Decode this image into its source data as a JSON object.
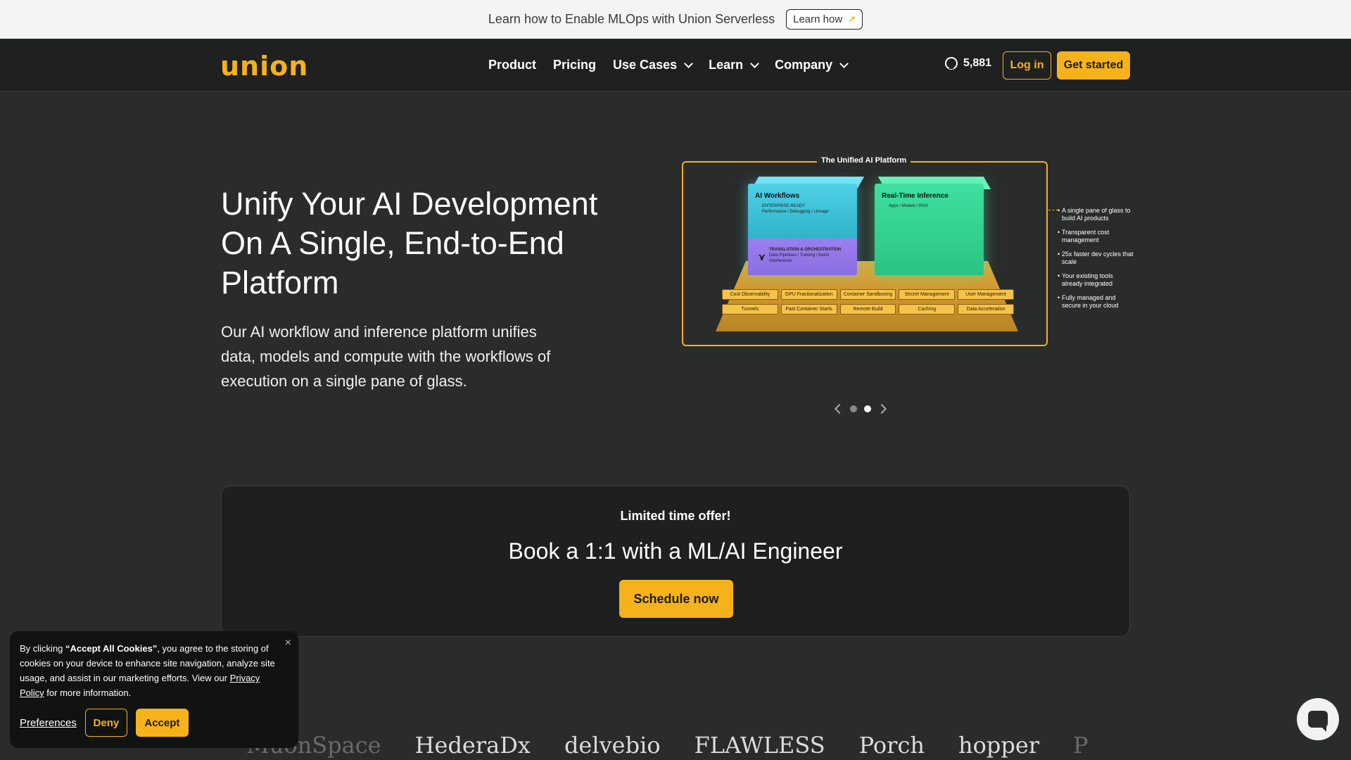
{
  "announcement": {
    "text": "Learn how to Enable MLOps with Union Serverless",
    "button": "Learn how",
    "button_icon": "arrow-up-right-icon"
  },
  "nav": {
    "logo": "union",
    "links": [
      {
        "label": "Product",
        "dropdown": false
      },
      {
        "label": "Pricing",
        "dropdown": false
      },
      {
        "label": "Use Cases",
        "dropdown": true
      },
      {
        "label": "Learn",
        "dropdown": true
      },
      {
        "label": "Company",
        "dropdown": true
      }
    ],
    "github_stars": "5,881",
    "login": "Log in",
    "get_started": "Get started"
  },
  "hero": {
    "title": "Unify Your AI Development On A Single, End-to-End Platform",
    "subtitle": "Our AI workflow and inference platform unifies data, models and compute with the workflows of execution on a single pane of glass."
  },
  "diagram": {
    "title": "The Unified AI Platform",
    "workflows_label": "AI Workflows",
    "workflows_sub": "ENTERPRISE-READY",
    "workflows_sub2": "Performance / Debugging / Lineage",
    "orchestration_label": "TRANSLATION & ORCHESTRATION",
    "orchestration_sub": "Data Pipelines / Training / Batch Interference",
    "inference_label": "Real-Time Inference",
    "inference_sub": "Apps / Models / RAG",
    "chips": [
      "Cost Observability",
      "GPU Fractionalization",
      "Container Sandboxing",
      "Secret Management",
      "User Management",
      "Tunnels",
      "Fast Container Starts",
      "Remote Build",
      "Caching",
      "Data Acceleration"
    ],
    "bullets": [
      "A single pane of glass to build AI products",
      "Transparent cost management",
      "25x faster dev cycles that scale",
      "Your existing tools already integrated",
      "Fully managed and secure in your cloud"
    ]
  },
  "carousel": {
    "current": 2,
    "total": 2
  },
  "offer": {
    "kicker": "Limited time offer!",
    "title": "Book a 1:1 with a ML/AI Engineer",
    "button": "Schedule now"
  },
  "logos": [
    "MuonSpace",
    "HederaDx",
    "delvebio",
    "FLAWLESS",
    "Porch",
    "hopper",
    "P"
  ],
  "cookie": {
    "text_prefix": "By clicking ",
    "text_bold": "“Accept All Cookies”",
    "text_middle": ", you agree to the storing of cookies on your device to enhance site navigation, analyze site usage, and assist in our marketing efforts. View our ",
    "text_link": "Privacy Policy",
    "text_suffix": " for more information.",
    "close": "×",
    "preferences": "Preferences",
    "deny": "Deny",
    "accept": "Accept"
  },
  "colors": {
    "accent": "#f5b21b",
    "background": "#2a2b2b",
    "nav_bg": "#1f2020"
  }
}
